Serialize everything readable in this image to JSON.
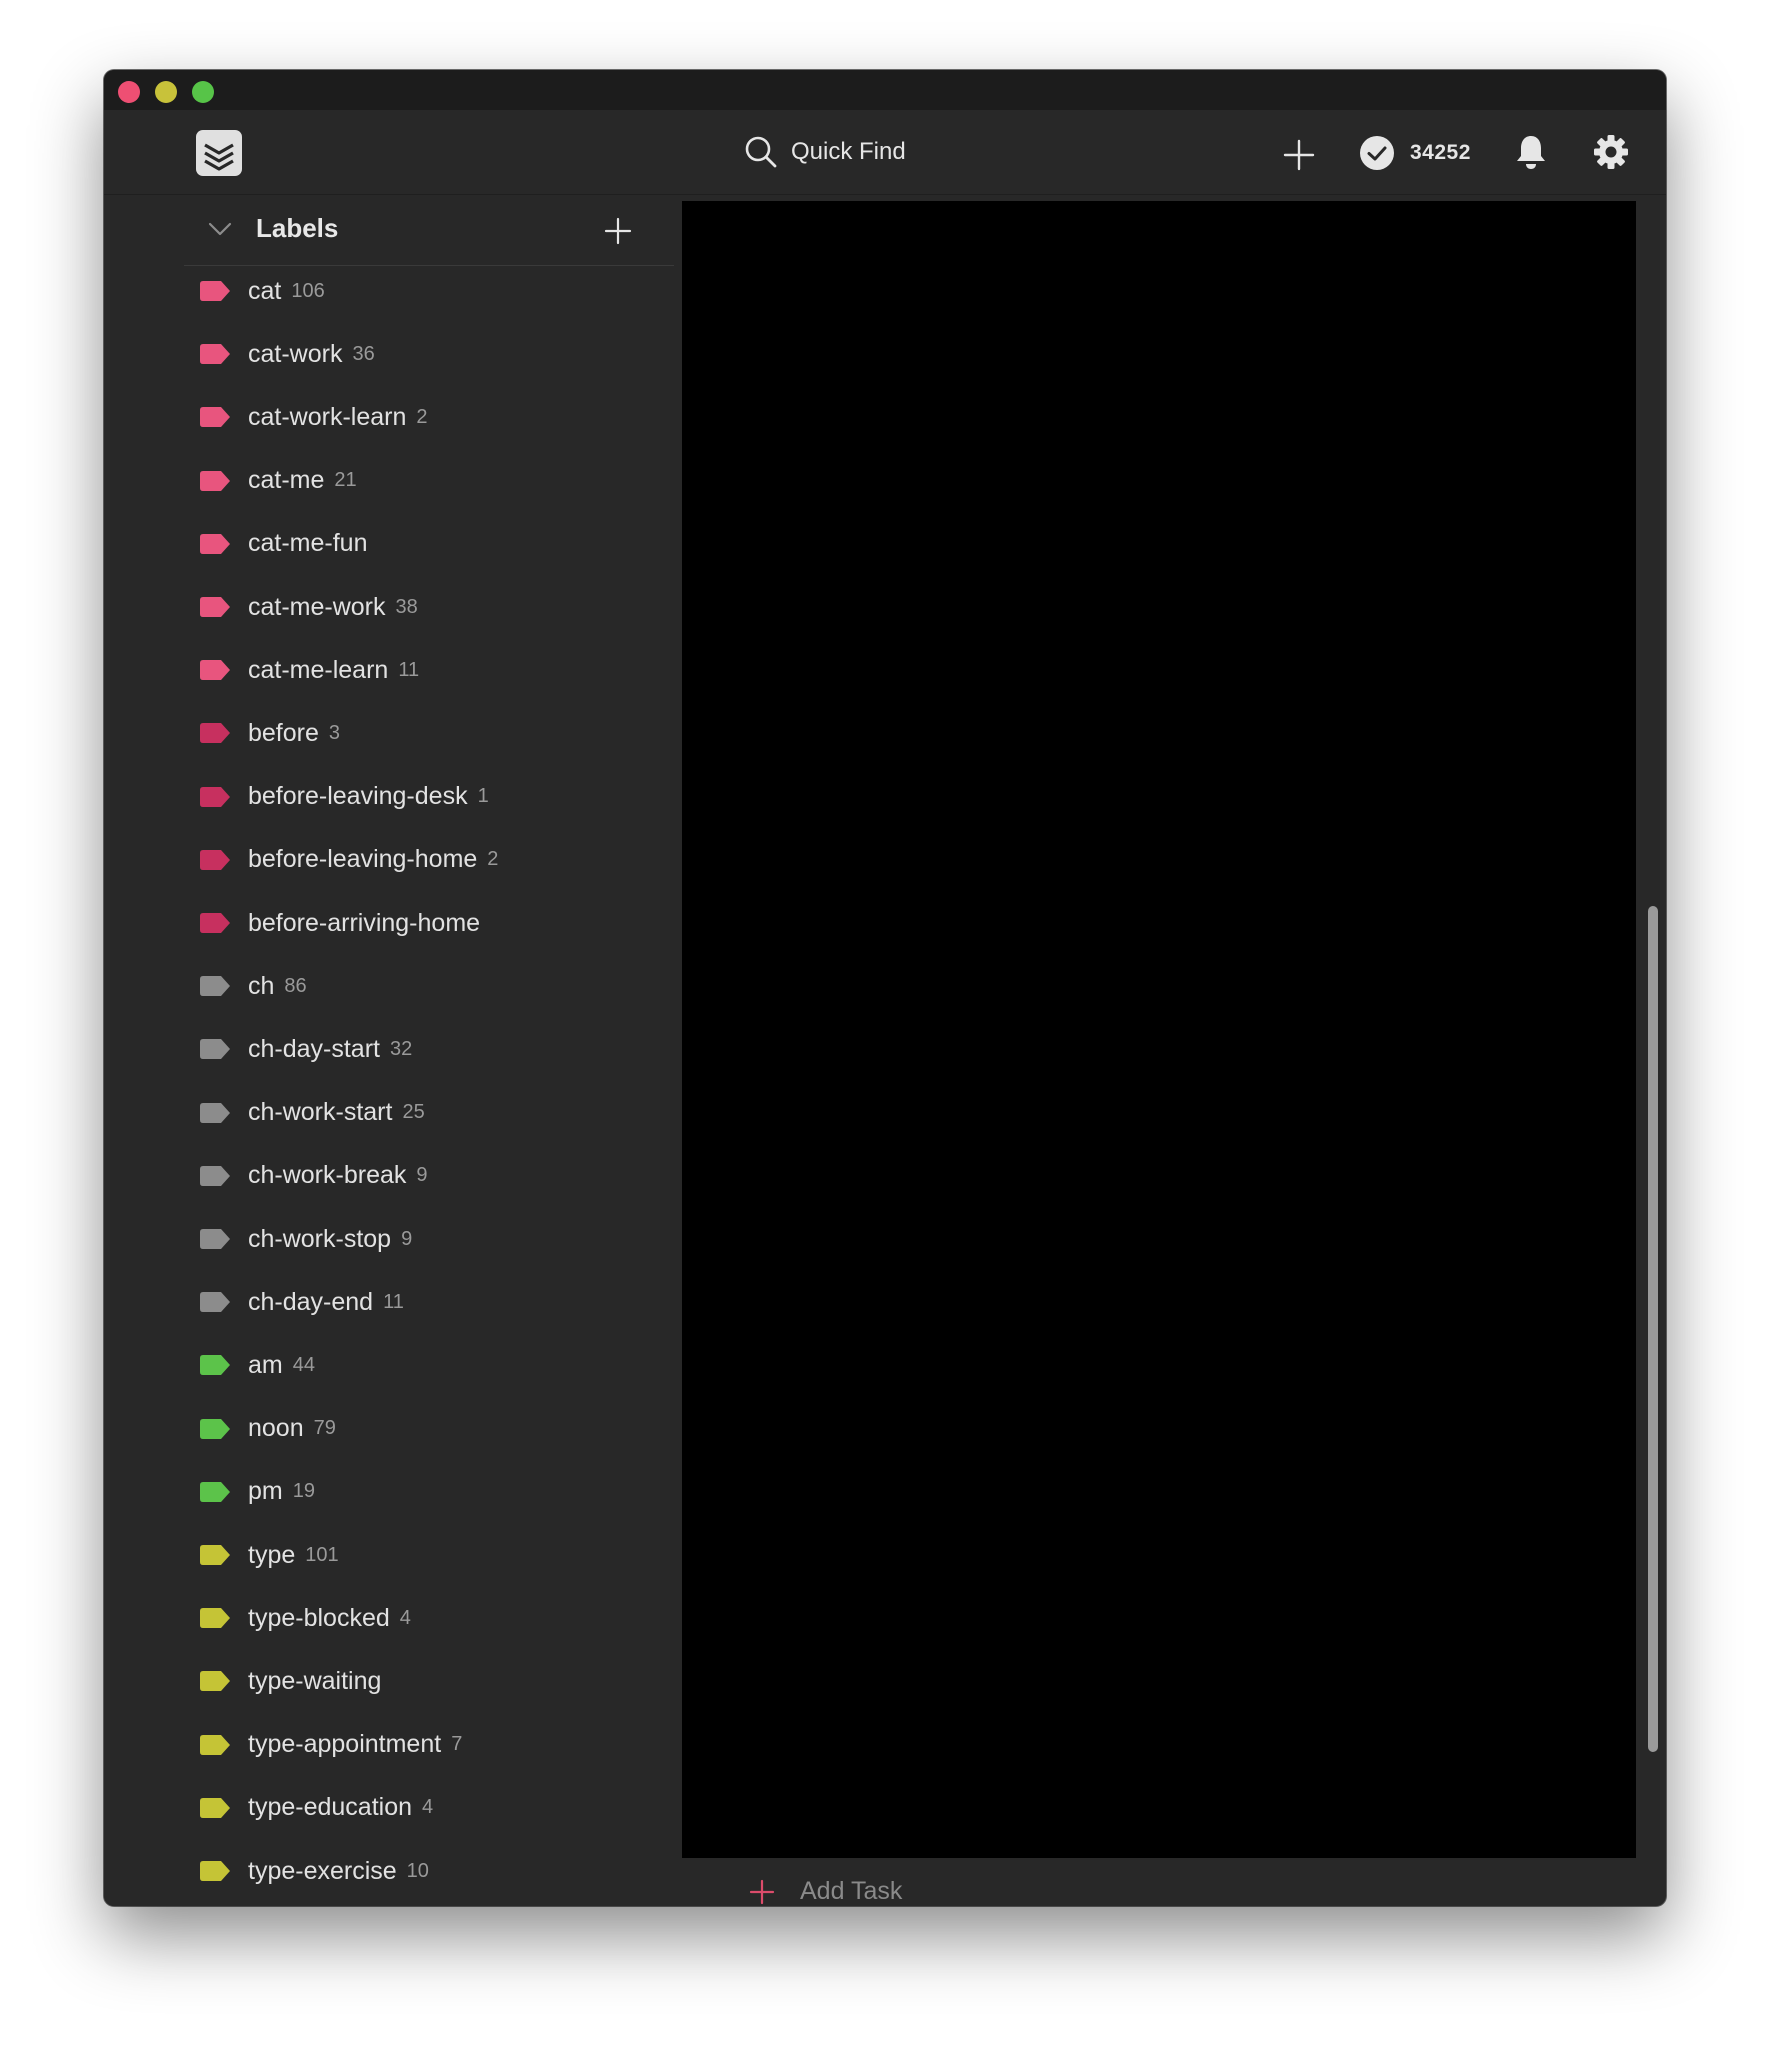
{
  "window": {
    "controls": [
      "close",
      "minimize",
      "zoom"
    ]
  },
  "header": {
    "logo_icon": "todoist-logo-icon",
    "search_label": "Quick Find",
    "search_icon": "search-icon",
    "add_icon": "plus-icon",
    "karma_icon": "check-circle-icon",
    "karma_value": "34252",
    "notifications_icon": "bell-icon",
    "settings_icon": "gear-icon"
  },
  "sidebar": {
    "section_title": "Labels",
    "labels": [
      {
        "name": "cat",
        "count": "106",
        "color": "#e8557e"
      },
      {
        "name": "cat-work",
        "count": "36",
        "color": "#e8557e"
      },
      {
        "name": "cat-work-learn",
        "count": "2",
        "color": "#e8557e"
      },
      {
        "name": "cat-me",
        "count": "21",
        "color": "#e8557e"
      },
      {
        "name": "cat-me-fun",
        "count": "",
        "color": "#e8557e"
      },
      {
        "name": "cat-me-work",
        "count": "38",
        "color": "#e8557e"
      },
      {
        "name": "cat-me-learn",
        "count": "11",
        "color": "#e8557e"
      },
      {
        "name": "before",
        "count": "3",
        "color": "#c7305f"
      },
      {
        "name": "before-leaving-desk",
        "count": "1",
        "color": "#c7305f"
      },
      {
        "name": "before-leaving-home",
        "count": "2",
        "color": "#c7305f"
      },
      {
        "name": "before-arriving-home",
        "count": "",
        "color": "#c7305f"
      },
      {
        "name": "ch",
        "count": "86",
        "color": "#8c8c8c"
      },
      {
        "name": "ch-day-start",
        "count": "32",
        "color": "#8c8c8c"
      },
      {
        "name": "ch-work-start",
        "count": "25",
        "color": "#8c8c8c"
      },
      {
        "name": "ch-work-break",
        "count": "9",
        "color": "#8c8c8c"
      },
      {
        "name": "ch-work-stop",
        "count": "9",
        "color": "#8c8c8c"
      },
      {
        "name": "ch-day-end",
        "count": "11",
        "color": "#8c8c8c"
      },
      {
        "name": "am",
        "count": "44",
        "color": "#5cc34a"
      },
      {
        "name": "noon",
        "count": "79",
        "color": "#5cc34a"
      },
      {
        "name": "pm",
        "count": "19",
        "color": "#5cc34a"
      },
      {
        "name": "type",
        "count": "101",
        "color": "#c5c436"
      },
      {
        "name": "type-blocked",
        "count": "4",
        "color": "#c5c436"
      },
      {
        "name": "type-waiting",
        "count": "",
        "color": "#c5c436"
      },
      {
        "name": "type-appointment",
        "count": "7",
        "color": "#c5c436"
      },
      {
        "name": "type-education",
        "count": "4",
        "color": "#c5c436"
      },
      {
        "name": "type-exercise",
        "count": "10",
        "color": "#c5c436"
      }
    ]
  },
  "main": {
    "add_task_label": "Add Task",
    "accent_color": "#dc4c6b"
  }
}
